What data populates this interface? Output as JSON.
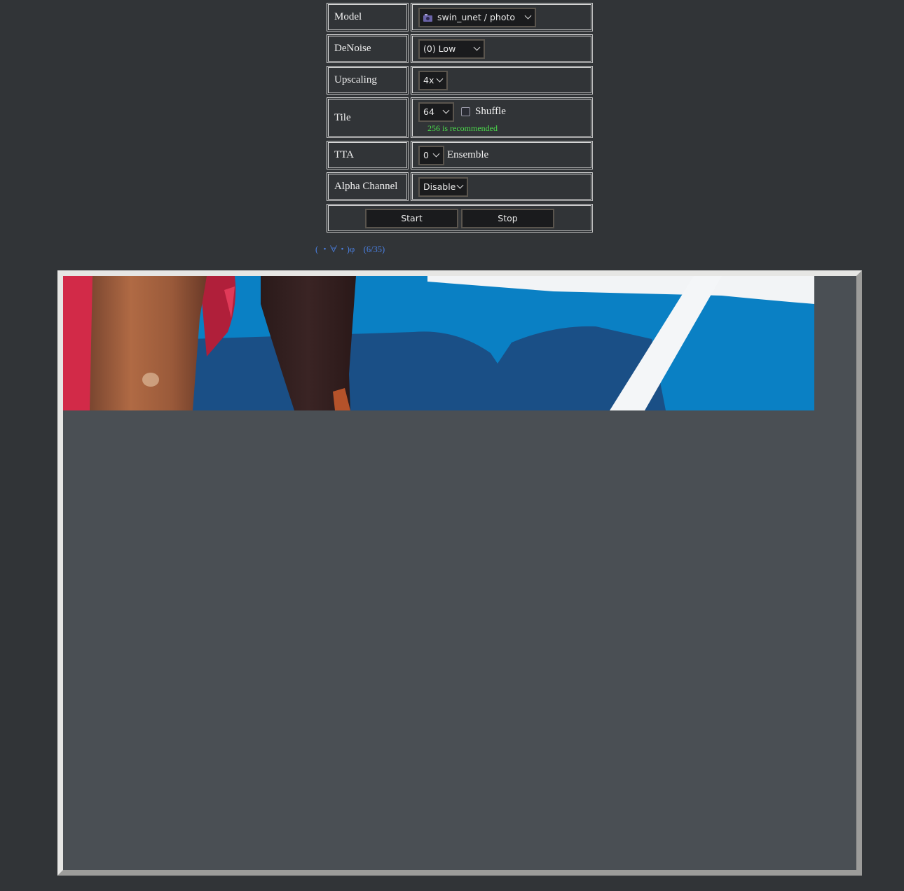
{
  "settings": {
    "model": {
      "label": "Model",
      "value": "swin_unet / photo",
      "icon": "camera-icon"
    },
    "denoise": {
      "label": "DeNoise",
      "value": "(0) Low"
    },
    "upscaling": {
      "label": "Upscaling",
      "value": "4x"
    },
    "tile": {
      "label": "Tile",
      "value": "64",
      "shuffle_label": "Shuffle",
      "shuffle_checked": false,
      "hint": "256 is recommended"
    },
    "tta": {
      "label": "TTA",
      "value": "0",
      "suffix": "Ensemble"
    },
    "alpha": {
      "label": "Alpha Channel",
      "value": "Disable"
    },
    "buttons": {
      "start": "Start",
      "stop": "Stop"
    }
  },
  "status": {
    "text": "( ・∀・)φ　(6/35)",
    "progress_current": 6,
    "progress_total": 35
  },
  "colors": {
    "background": "#313437",
    "canvas_bg": "#4a4f54",
    "hint_green": "#4cdb4c",
    "status_blue": "#4a7fe0"
  }
}
